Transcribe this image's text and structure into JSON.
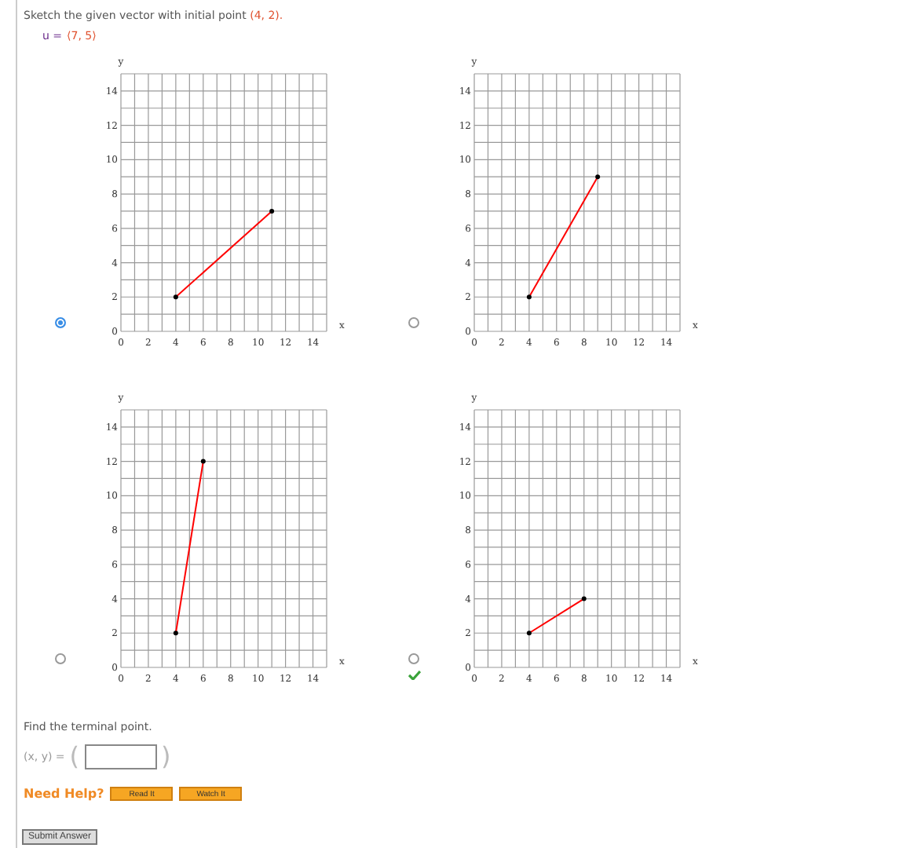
{
  "prompt": {
    "text": "Sketch the given vector with initial point",
    "point": "(4, 2)."
  },
  "vector": {
    "label": "u =",
    "value": "⟨7, 5⟩"
  },
  "options": [
    {
      "selected": true,
      "correct": false,
      "chart_data": {
        "type": "line",
        "xlabel": "x",
        "ylabel": "y",
        "grid": true,
        "x": [
          4,
          11
        ],
        "series": [
          {
            "color": "#ff0000",
            "marker": true,
            "values": [
              2,
              7
            ]
          }
        ],
        "xlim": [
          0,
          15
        ],
        "ylim": [
          0,
          15
        ],
        "xticks": [
          0,
          2,
          4,
          6,
          8,
          10,
          12,
          14
        ],
        "yticks": [
          0,
          2,
          4,
          6,
          8,
          10,
          12,
          14
        ]
      }
    },
    {
      "selected": false,
      "correct": false,
      "chart_data": {
        "type": "line",
        "xlabel": "x",
        "ylabel": "y",
        "grid": true,
        "x": [
          4,
          9
        ],
        "series": [
          {
            "color": "#ff0000",
            "marker": true,
            "values": [
              2,
              9
            ]
          }
        ],
        "xlim": [
          0,
          15
        ],
        "ylim": [
          0,
          15
        ],
        "xticks": [
          0,
          2,
          4,
          6,
          8,
          10,
          12,
          14
        ],
        "yticks": [
          0,
          2,
          4,
          6,
          8,
          10,
          12,
          14
        ]
      }
    },
    {
      "selected": false,
      "correct": false,
      "chart_data": {
        "type": "line",
        "xlabel": "x",
        "ylabel": "y",
        "grid": true,
        "x": [
          4,
          6
        ],
        "series": [
          {
            "color": "#ff0000",
            "marker": true,
            "values": [
              2,
              12
            ]
          }
        ],
        "xlim": [
          0,
          15
        ],
        "ylim": [
          0,
          15
        ],
        "xticks": [
          0,
          2,
          4,
          6,
          8,
          10,
          12,
          14
        ],
        "yticks": [
          0,
          2,
          4,
          6,
          8,
          10,
          12,
          14
        ]
      }
    },
    {
      "selected": false,
      "correct": true,
      "chart_data": {
        "type": "line",
        "xlabel": "x",
        "ylabel": "y",
        "grid": true,
        "x": [
          4,
          8
        ],
        "series": [
          {
            "color": "#ff0000",
            "marker": true,
            "values": [
              2,
              4
            ]
          }
        ],
        "xlim": [
          0,
          15
        ],
        "ylim": [
          0,
          15
        ],
        "xticks": [
          0,
          2,
          4,
          6,
          8,
          10,
          12,
          14
        ],
        "yticks": [
          0,
          2,
          4,
          6,
          8,
          10,
          12,
          14
        ]
      }
    }
  ],
  "terminal": {
    "question": "Find the terminal point.",
    "label": "(x, y) =",
    "open": "(",
    "close": ")"
  },
  "help": {
    "label": "Need Help?",
    "buttons": [
      "Read It",
      "Watch It"
    ]
  },
  "submit": "Submit Answer"
}
